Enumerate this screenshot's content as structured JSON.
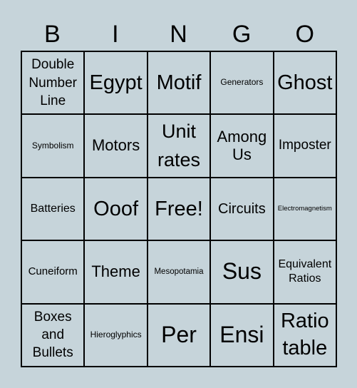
{
  "header": {
    "letters": [
      "B",
      "I",
      "N",
      "G",
      "O"
    ]
  },
  "grid": {
    "rows": [
      [
        "Double Number Line",
        "Egypt",
        "Motif",
        "Generators",
        "Ghost"
      ],
      [
        "Symbolism",
        "Motors",
        "Unit rates",
        "Among Us",
        "Imposter"
      ],
      [
        "Batteries",
        "Ooof",
        "Free!",
        "Circuits",
        "Electromagnetism"
      ],
      [
        "Cuneiform",
        "Theme",
        "Mesopotamia",
        "Sus",
        "Equivalent Ratios"
      ],
      [
        "Boxes and Bullets",
        "Hieroglyphics",
        "Per",
        "Ensi",
        "Ratio table"
      ]
    ]
  }
}
